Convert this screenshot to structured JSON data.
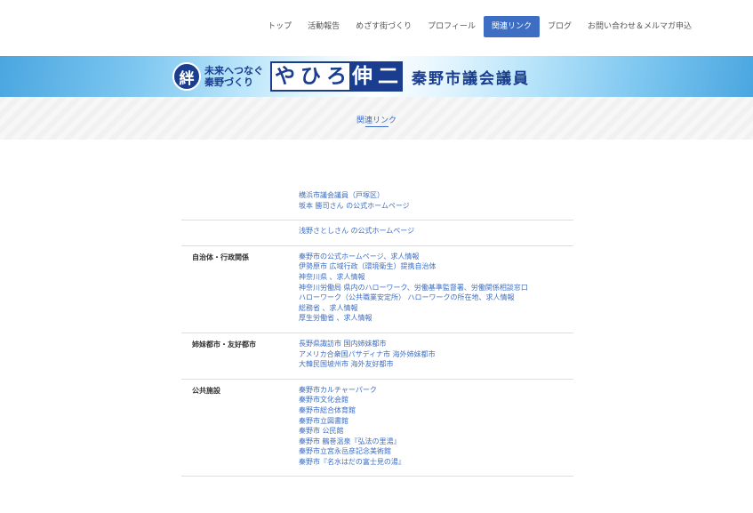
{
  "nav": {
    "items": [
      {
        "label": "トップ",
        "active": false
      },
      {
        "label": "活動報告",
        "active": false
      },
      {
        "label": "めざす街づくり",
        "active": false
      },
      {
        "label": "プロフィール",
        "active": false
      },
      {
        "label": "関連リンク",
        "active": true
      },
      {
        "label": "ブログ",
        "active": false
      },
      {
        "label": "お問い合わせ＆メルマガ申込",
        "active": false
      }
    ]
  },
  "banner": {
    "kizuna": "絆",
    "motto_line1": "未来へつなぐ",
    "motto_line2": "秦野づくり",
    "name_chars": [
      "や",
      "ひ",
      "ろ",
      "伸",
      "二"
    ],
    "role": "秦野市議会議員"
  },
  "page": {
    "title": "関連リンク"
  },
  "sections": [
    {
      "label": "",
      "links": [
        "横浜市議会議員（戸塚区）",
        "坂本 勝司さん の公式ホームページ"
      ]
    },
    {
      "label": "",
      "links": [
        "浅野さとしさん の公式ホームページ"
      ]
    },
    {
      "label": "自治体・行政関係",
      "links": [
        "秦野市の公式ホームページ、求人情報",
        "伊勢原市 広域行政（環境衛生）提携自治体",
        "神奈川県 、求人情報",
        "神奈川労働局 県内のハローワーク、労働基準監督署、労働関係相談窓口",
        "ハローワーク（公共職業安定所） ハローワークの所在地、求人情報",
        "総務省 、求人情報",
        "厚生労働省 、求人情報"
      ]
    },
    {
      "label": "姉妹都市・友好都市",
      "links": [
        "長野県諏訪市 国内姉妹都市",
        "アメリカ合衆国パサディナ市 海外姉妹都市",
        "大韓民国坡州市 海外友好都市"
      ]
    },
    {
      "label": "公共施設",
      "links": [
        "秦野市カルチャーパーク",
        "秦野市文化会館",
        "秦野市総合体育館",
        "秦野市立図書館",
        "秦野市 公民館",
        "秦野市 鶴巻温泉『弘法の里湯』",
        "秦野市立宮永岳彦記念美術館",
        "秦野市『名水はだの富士見の湯』"
      ]
    }
  ]
}
